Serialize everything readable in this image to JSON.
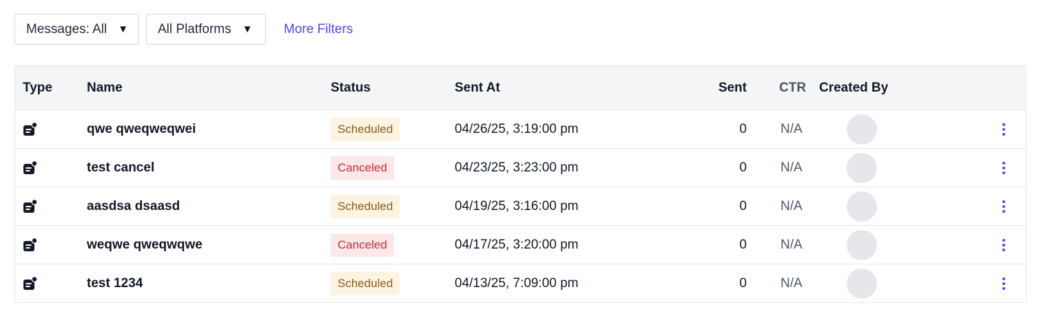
{
  "filters": {
    "messages_label": "Messages: All",
    "platforms_label": "All Platforms",
    "more_filters": "More Filters",
    "caret": "▼"
  },
  "table": {
    "headers": {
      "type": "Type",
      "name": "Name",
      "status": "Status",
      "sent_at": "Sent At",
      "sent": "Sent",
      "ctr": "CTR",
      "created_by": "Created By"
    },
    "rows": [
      {
        "type_icon": "message-notification-icon",
        "name": "qwe qweqweqwei",
        "status": "Scheduled",
        "sent_at": "04/26/25, 3:19:00 pm",
        "sent": "0",
        "ctr": "N/A"
      },
      {
        "type_icon": "message-notification-icon",
        "name": "test cancel",
        "status": "Canceled",
        "sent_at": "04/23/25, 3:23:00 pm",
        "sent": "0",
        "ctr": "N/A"
      },
      {
        "type_icon": "message-notification-icon",
        "name": "aasdsa dsaasd",
        "status": "Scheduled",
        "sent_at": "04/19/25, 3:16:00 pm",
        "sent": "0",
        "ctr": "N/A"
      },
      {
        "type_icon": "message-notification-icon",
        "name": "weqwe qweqwqwe",
        "status": "Canceled",
        "sent_at": "04/17/25, 3:20:00 pm",
        "sent": "0",
        "ctr": "N/A"
      },
      {
        "type_icon": "message-notification-icon",
        "name": "test 1234",
        "status": "Scheduled",
        "sent_at": "04/13/25, 7:09:00 pm",
        "sent": "0",
        "ctr": "N/A"
      }
    ]
  },
  "colors": {
    "accent": "#4f46e5",
    "scheduled_bg": "#fdf3e1",
    "scheduled_text": "#8a5a1c",
    "canceled_bg": "#fde8e8",
    "canceled_text": "#c0303a"
  }
}
